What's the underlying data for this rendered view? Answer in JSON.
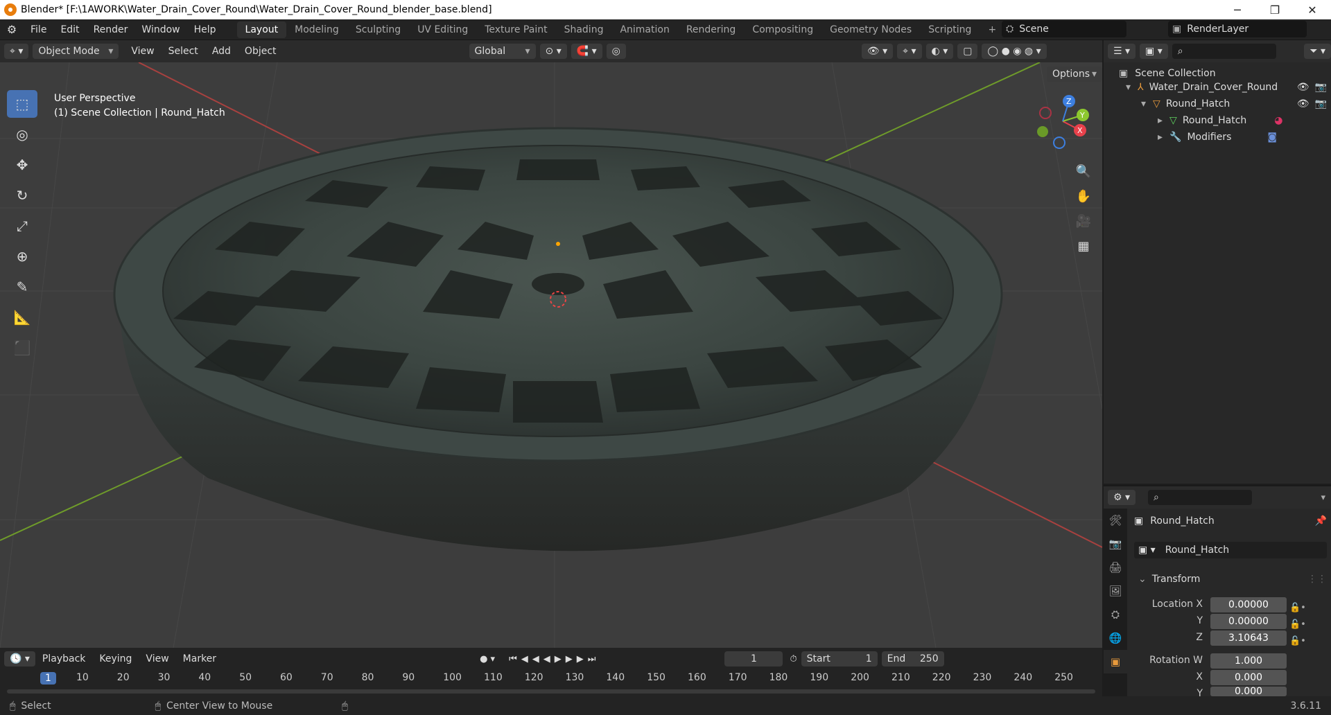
{
  "window": {
    "title": "Blender* [F:\\1AWORK\\Water_Drain_Cover_Round\\Water_Drain_Cover_Round_blender_base.blend]",
    "minimize": "─",
    "maximize": "❐",
    "close": "✕"
  },
  "menu": [
    "File",
    "Edit",
    "Render",
    "Window",
    "Help"
  ],
  "workspaces": [
    "Layout",
    "Modeling",
    "Sculpting",
    "UV Editing",
    "Texture Paint",
    "Shading",
    "Animation",
    "Rendering",
    "Compositing",
    "Geometry Nodes",
    "Scripting"
  ],
  "active_workspace": "Layout",
  "add_workspace": "+",
  "scene": "Scene",
  "render_layer": "RenderLayer",
  "viewport_header": {
    "mode": "Object Mode",
    "menus": [
      "View",
      "Select",
      "Add",
      "Object"
    ],
    "orientation": "Global",
    "options": "Options"
  },
  "viewport_overlay": {
    "line1": "User Perspective",
    "line2": "(1) Scene Collection | Round_Hatch"
  },
  "gizmo": {
    "x": "X",
    "y": "Y",
    "z": "Z"
  },
  "outliner": {
    "root": "Scene Collection",
    "items": [
      "Water_Drain_Cover_Round",
      "Round_Hatch",
      "Round_Hatch",
      "Modifiers"
    ]
  },
  "properties": {
    "object_name": "Round_Hatch",
    "datablock": "Round_Hatch",
    "panel": "Transform",
    "location_label": "Location X",
    "loc_x": "0.00000",
    "y_label": "Y",
    "loc_y": "0.00000",
    "z_label": "Z",
    "loc_z": "3.10643",
    "rotation_label": "Rotation W",
    "rot_w": "1.000",
    "x_label": "X",
    "rot_x": "0.000",
    "ry_label": "Y",
    "rot_y": "0.000"
  },
  "timeline": {
    "menus": [
      "Playback",
      "Keying",
      "View",
      "Marker"
    ],
    "current_frame": "1",
    "start_label": "Start",
    "start": "1",
    "end_label": "End",
    "end": "250",
    "ticks": [
      "1",
      "10",
      "20",
      "30",
      "40",
      "50",
      "60",
      "70",
      "80",
      "90",
      "100",
      "110",
      "120",
      "130",
      "140",
      "150",
      "160",
      "170",
      "180",
      "190",
      "200",
      "210",
      "220",
      "230",
      "240",
      "250"
    ]
  },
  "statusbar": {
    "select": "Select",
    "center": "Center View to Mouse",
    "version": "3.6.11"
  },
  "colors": {
    "accent": "#4772b3",
    "x_axis": "#e8414b",
    "y_axis": "#8dc82f",
    "z_axis": "#3d7fe0",
    "frame_active": "#4772b3"
  }
}
